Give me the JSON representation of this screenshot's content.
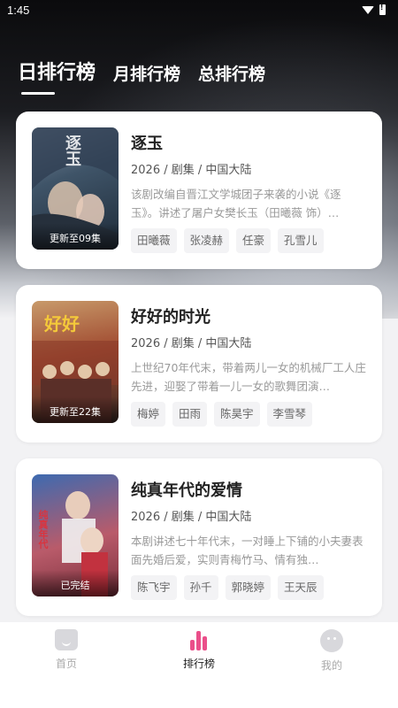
{
  "status_bar": {
    "time": "1:45"
  },
  "tabs": [
    {
      "label": "日排行榜",
      "active": true
    },
    {
      "label": "月排行榜",
      "active": false
    },
    {
      "label": "总排行榜",
      "active": false
    }
  ],
  "dramas": [
    {
      "title": "逐玉",
      "meta": "2026 / 剧集 / 中国大陆",
      "description": "该剧改编自晋江文学城团子来袭的小说《逐玉》。讲述了屠户女樊长玉（田曦薇 饰）…",
      "badge": "更新至09集",
      "actors": [
        "田曦薇",
        "张凌赫",
        "任豪",
        "孔雪儿"
      ],
      "poster_art": "逐玉"
    },
    {
      "title": "好好的时光",
      "meta": "2026 / 剧集 / 中国大陆",
      "description": "上世纪70年代末，带着两儿一女的机械厂工人庄先进，迎娶了带着一儿一女的歌舞团演…",
      "badge": "更新至22集",
      "actors": [
        "梅婷",
        "田雨",
        "陈昊宇",
        "李雪琴"
      ],
      "poster_art": "好好"
    },
    {
      "title": "纯真年代的爱情",
      "meta": "2026 / 剧集 / 中国大陆",
      "description": "本剧讲述七十年代末，一对睡上下铺的小夫妻表面先婚后爱，实则青梅竹马、情有独…",
      "badge": "已完结",
      "actors": [
        "陈飞宇",
        "孙千",
        "郭晓婷",
        "王天辰"
      ],
      "poster_art": "纯真年代"
    }
  ],
  "bottom_nav": [
    {
      "label": "首页",
      "icon": "home-icon",
      "active": false
    },
    {
      "label": "排行榜",
      "icon": "ranking-icon",
      "active": true
    },
    {
      "label": "我的",
      "icon": "profile-icon",
      "active": false
    }
  ],
  "colors": {
    "accent": "#ea4f8a",
    "card_bg": "#ffffff",
    "page_bg": "#f2f2f4"
  }
}
